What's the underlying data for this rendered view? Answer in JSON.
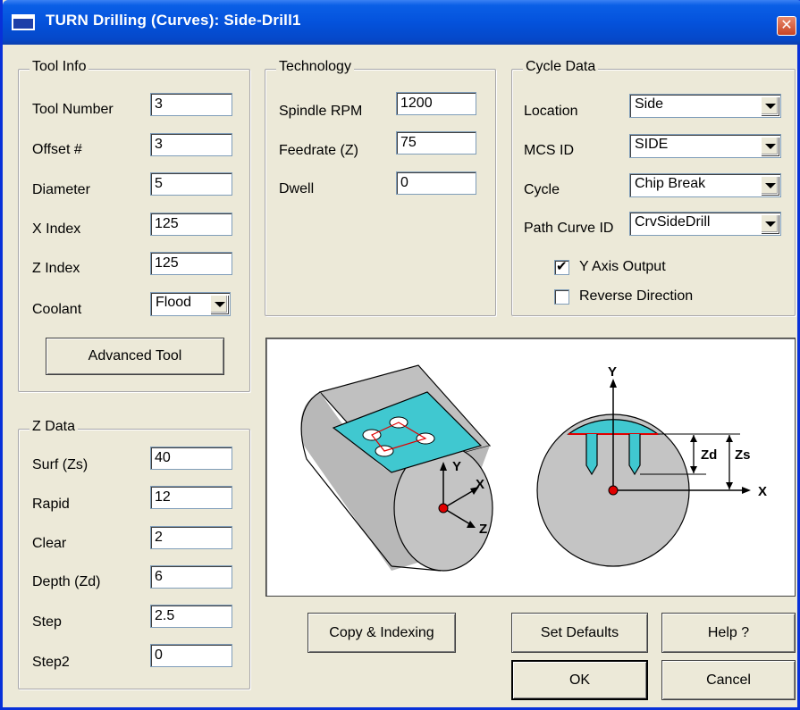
{
  "window": {
    "title": "TURN Drilling (Curves): Side-Drill1",
    "close_glyph": "✕"
  },
  "tool_info": {
    "group_label": "Tool Info",
    "tool_number": {
      "label": "Tool Number",
      "value": "3"
    },
    "offset": {
      "label": "Offset #",
      "value": "3"
    },
    "diameter": {
      "label": "Diameter",
      "value": "5"
    },
    "x_index": {
      "label": "X Index",
      "value": "125"
    },
    "z_index": {
      "label": "Z Index",
      "value": "125"
    },
    "coolant": {
      "label": "Coolant",
      "value": "Flood"
    },
    "advanced_button": "Advanced Tool"
  },
  "technology": {
    "group_label": "Technology",
    "spindle_rpm": {
      "label": "Spindle RPM",
      "value": "1200"
    },
    "feedrate": {
      "label": "Feedrate (Z)",
      "value": "75"
    },
    "dwell": {
      "label": "Dwell",
      "value": "0"
    }
  },
  "cycle_data": {
    "group_label": "Cycle Data",
    "location": {
      "label": "Location",
      "value": "Side"
    },
    "mcs_id": {
      "label": "MCS ID",
      "value": "SIDE"
    },
    "cycle": {
      "label": "Cycle",
      "value": "Chip Break"
    },
    "path_curve_id": {
      "label": "Path Curve ID",
      "value": "CrvSideDrill"
    },
    "y_axis_output": {
      "label": "Y Axis Output",
      "checked": true
    },
    "reverse_direction": {
      "label": "Reverse Direction",
      "checked": false
    }
  },
  "z_data": {
    "group_label": "Z Data",
    "surf": {
      "label": "Surf (Zs)",
      "value": "40"
    },
    "rapid": {
      "label": "Rapid",
      "value": "12"
    },
    "clear": {
      "label": "Clear",
      "value": "2"
    },
    "depth": {
      "label": "Depth (Zd)",
      "value": "6"
    },
    "step": {
      "label": "Step",
      "value": "2.5"
    },
    "step2": {
      "label": "Step2",
      "value": "0"
    }
  },
  "diagram": {
    "left_axes": {
      "y": "Y",
      "x": "X",
      "z": "Z"
    },
    "right_axes": {
      "y": "Y",
      "x": "X"
    },
    "dim_zd": "Zd",
    "dim_zs": "Zs",
    "colors": {
      "body": "#c0c0c0",
      "cutout": "#40c8d0",
      "origin": "#e00000",
      "hole_outline": "#e00000"
    }
  },
  "buttons": {
    "copy_indexing": "Copy & Indexing",
    "set_defaults": "Set Defaults",
    "help": "Help ?",
    "ok": "OK",
    "cancel": "Cancel"
  },
  "checkmark_glyph": "✔"
}
